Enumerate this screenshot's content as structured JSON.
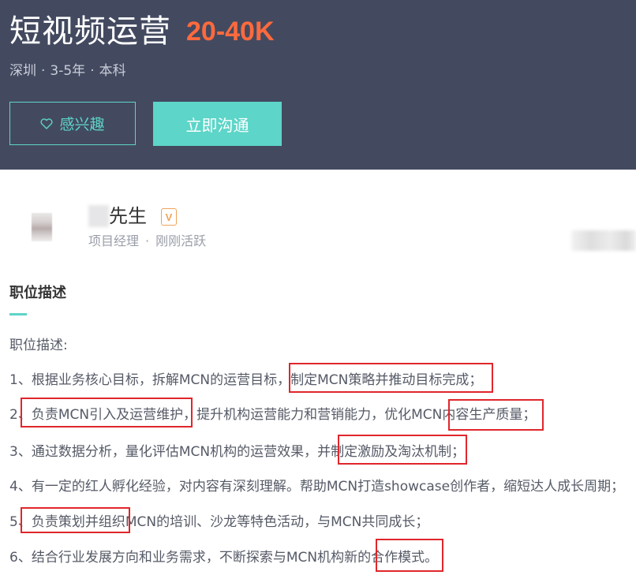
{
  "job": {
    "title": "短视频运营",
    "salary": "20-40K",
    "location": "深圳",
    "experience": "3-5年",
    "education": "本科",
    "separator": "·"
  },
  "actions": {
    "interest_label": "感兴趣",
    "chat_label": "立即沟通"
  },
  "recruiter": {
    "name": "先生",
    "verified_badge": "V",
    "role": "项目经理",
    "status": "刚刚活跃",
    "separator": "·"
  },
  "description": {
    "section_title": "职位描述",
    "heading": "职位描述:",
    "items": [
      "1、根据业务核心目标，拆解MCN的运营目标，制定MCN策略并推动目标完成；",
      "2、负责MCN引入及运营维护，提升机构运营能力和营销能力，优化MCN内容生产质量；",
      "3、通过数据分析，量化评估MCN机构的运营效果，并制定激励及淘汰机制；",
      "4、有一定的红人孵化经验，对内容有深刻理解。帮助MCN打造showcase创作者，缩短达人成长周期；",
      "5、负责策划并组织MCN的培训、沙龙等特色活动，与MCN共同成长；",
      "6、结合行业发展方向和业务需求，不断探索与MCN机构新的合作模式。"
    ]
  },
  "colors": {
    "header_bg": "#434a60",
    "accent": "#5dd5c8",
    "salary": "#ff6a3d",
    "highlight_box": "#e0262b"
  },
  "icons": {
    "interest": "heart-outline-icon"
  }
}
